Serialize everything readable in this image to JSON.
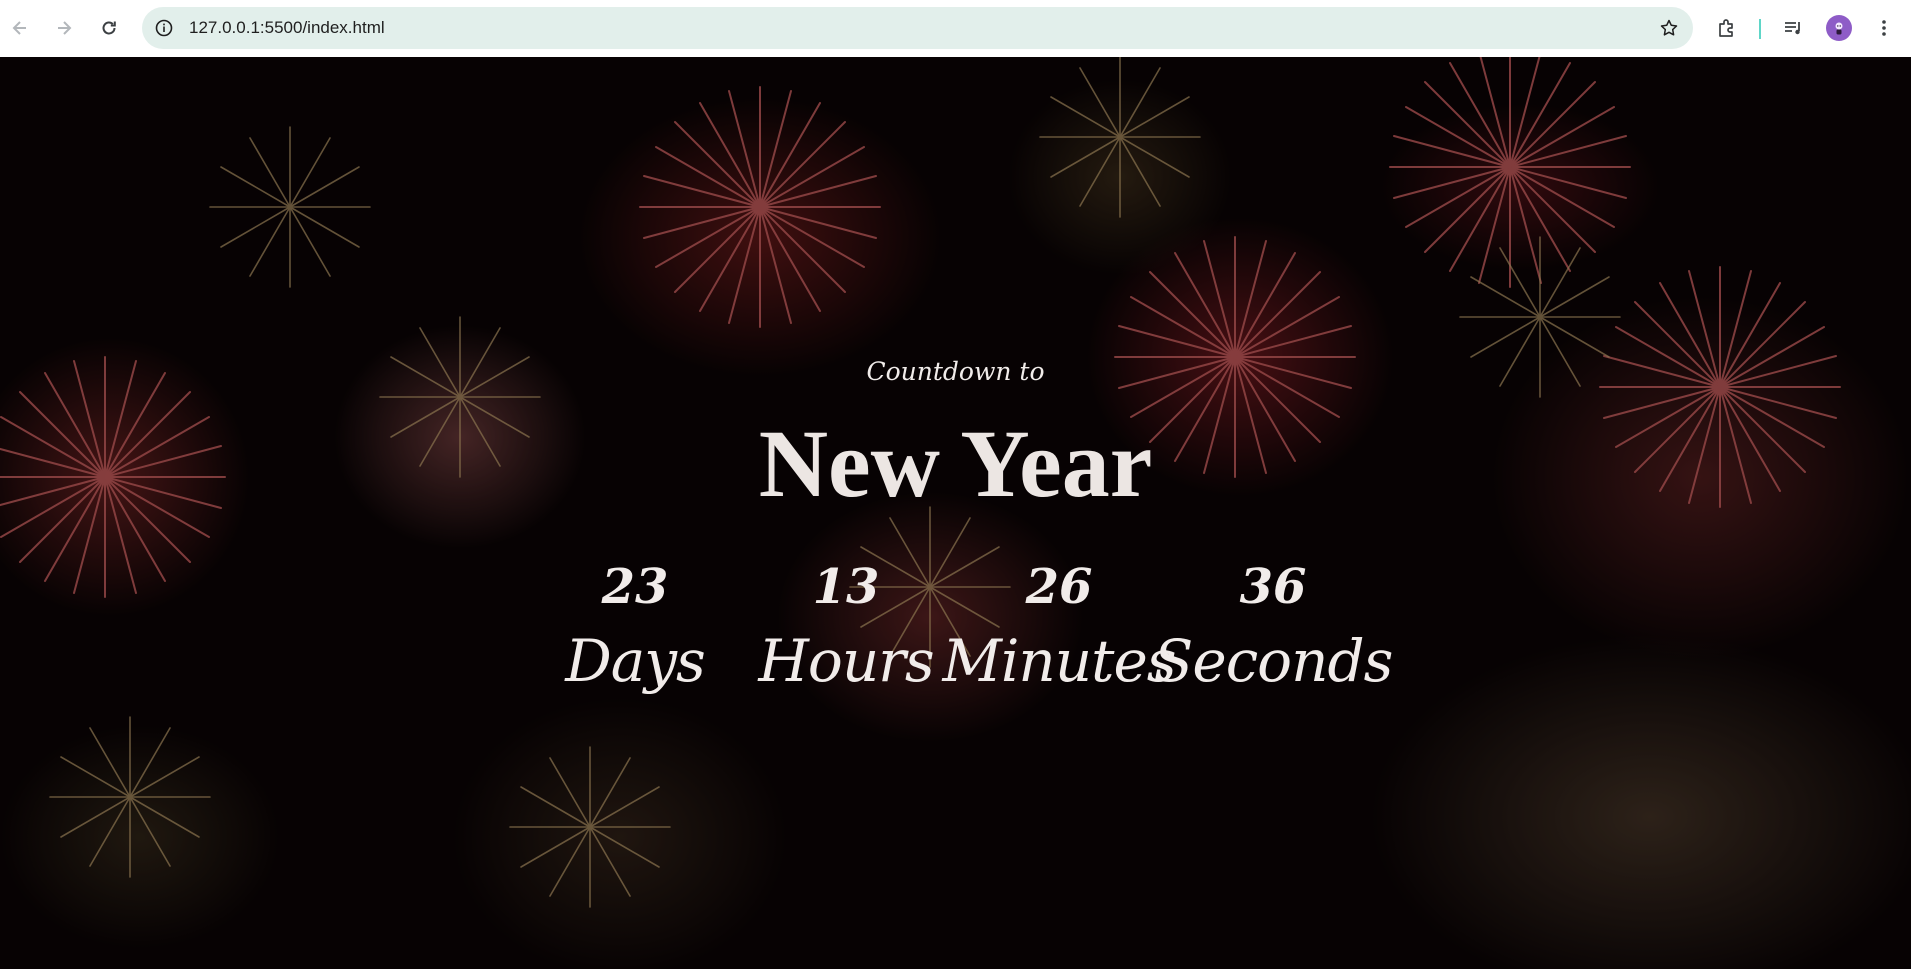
{
  "browser": {
    "url": "127.0.0.1:5500/index.html",
    "icons": {
      "back": "arrow-left-icon",
      "forward": "arrow-right-icon",
      "reload": "reload-icon",
      "site_info": "info-icon",
      "bookmark": "star-icon",
      "extensions": "puzzle-icon",
      "media": "media-queue-icon",
      "profile": "avatar-icon",
      "menu": "three-dots-vertical-icon"
    }
  },
  "page": {
    "subtitle": "Countdown to",
    "title": "New Year",
    "countdown": [
      {
        "value": "23",
        "label": "Days"
      },
      {
        "value": "13",
        "label": "Hours"
      },
      {
        "value": "26",
        "label": "Minutes"
      },
      {
        "value": "36",
        "label": "Seconds"
      }
    ]
  },
  "colors": {
    "omnibox_bg": "#e2efeb",
    "text_light": "#ece6e3",
    "background_dark": "#0b0405",
    "firework_red": "#c83a3a",
    "firework_gold": "#c9a46a",
    "avatar": "#8e5cc7"
  }
}
